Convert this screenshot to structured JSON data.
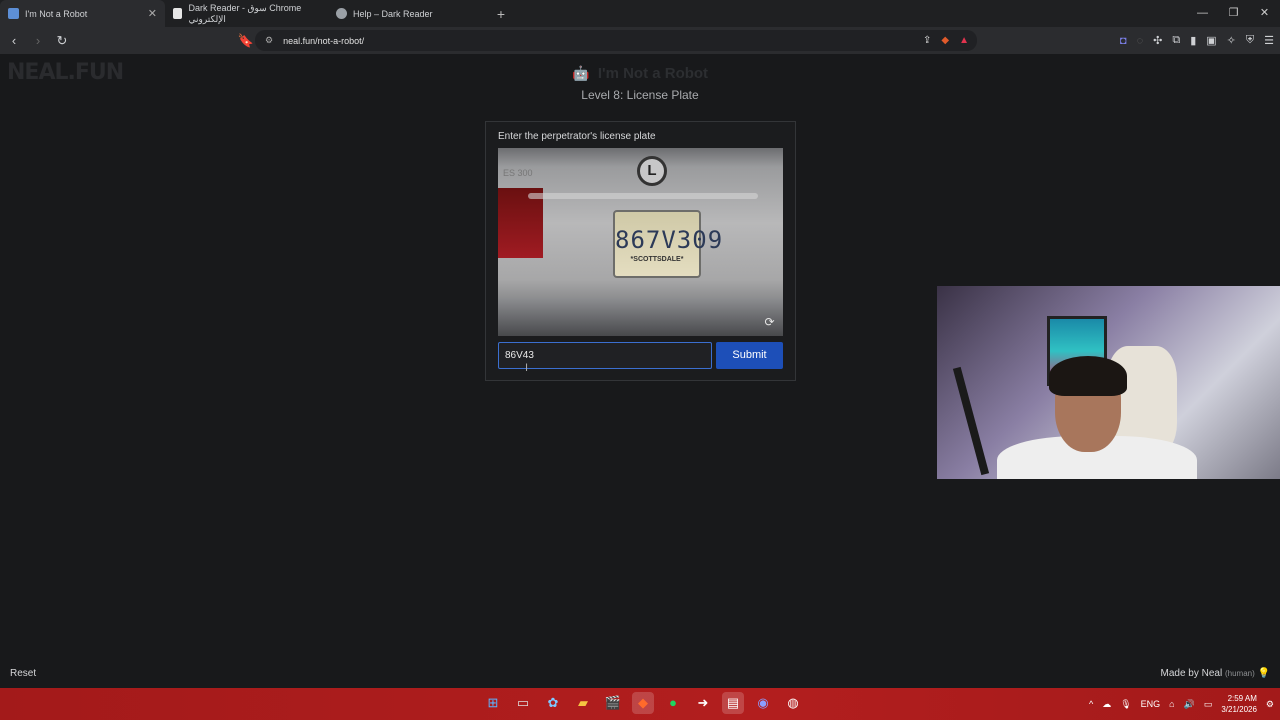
{
  "browser": {
    "tabs": [
      {
        "title": "I'm Not a Robot",
        "active": true
      },
      {
        "title": "Dark Reader - سوق Chrome الإلكتروني",
        "active": false
      },
      {
        "title": "Help – Dark Reader",
        "active": false
      }
    ],
    "url": "neal.fun/not-a-robot/"
  },
  "page": {
    "logo": "NEAL.FUN",
    "title": "I'm Not a Robot",
    "level": "Level 8: License Plate",
    "prompt": "Enter the perpetrator's license plate",
    "plate_image": {
      "plate_number": "867V309",
      "plate_subtext": "*SCOTTSDALE*",
      "model_badge": "ES 300"
    },
    "answer_value": "86V43",
    "submit_label": "Submit",
    "reset_label": "Reset",
    "made_by": "Made by Neal",
    "made_by_note": "(human)"
  },
  "taskbar": {
    "lang": "ENG",
    "time": "2:59 AM",
    "date": "3/21/2026"
  },
  "colors": {
    "accent": "#1d4fb8",
    "taskbar": "#b21e1e",
    "page_bg": "#18191b"
  }
}
